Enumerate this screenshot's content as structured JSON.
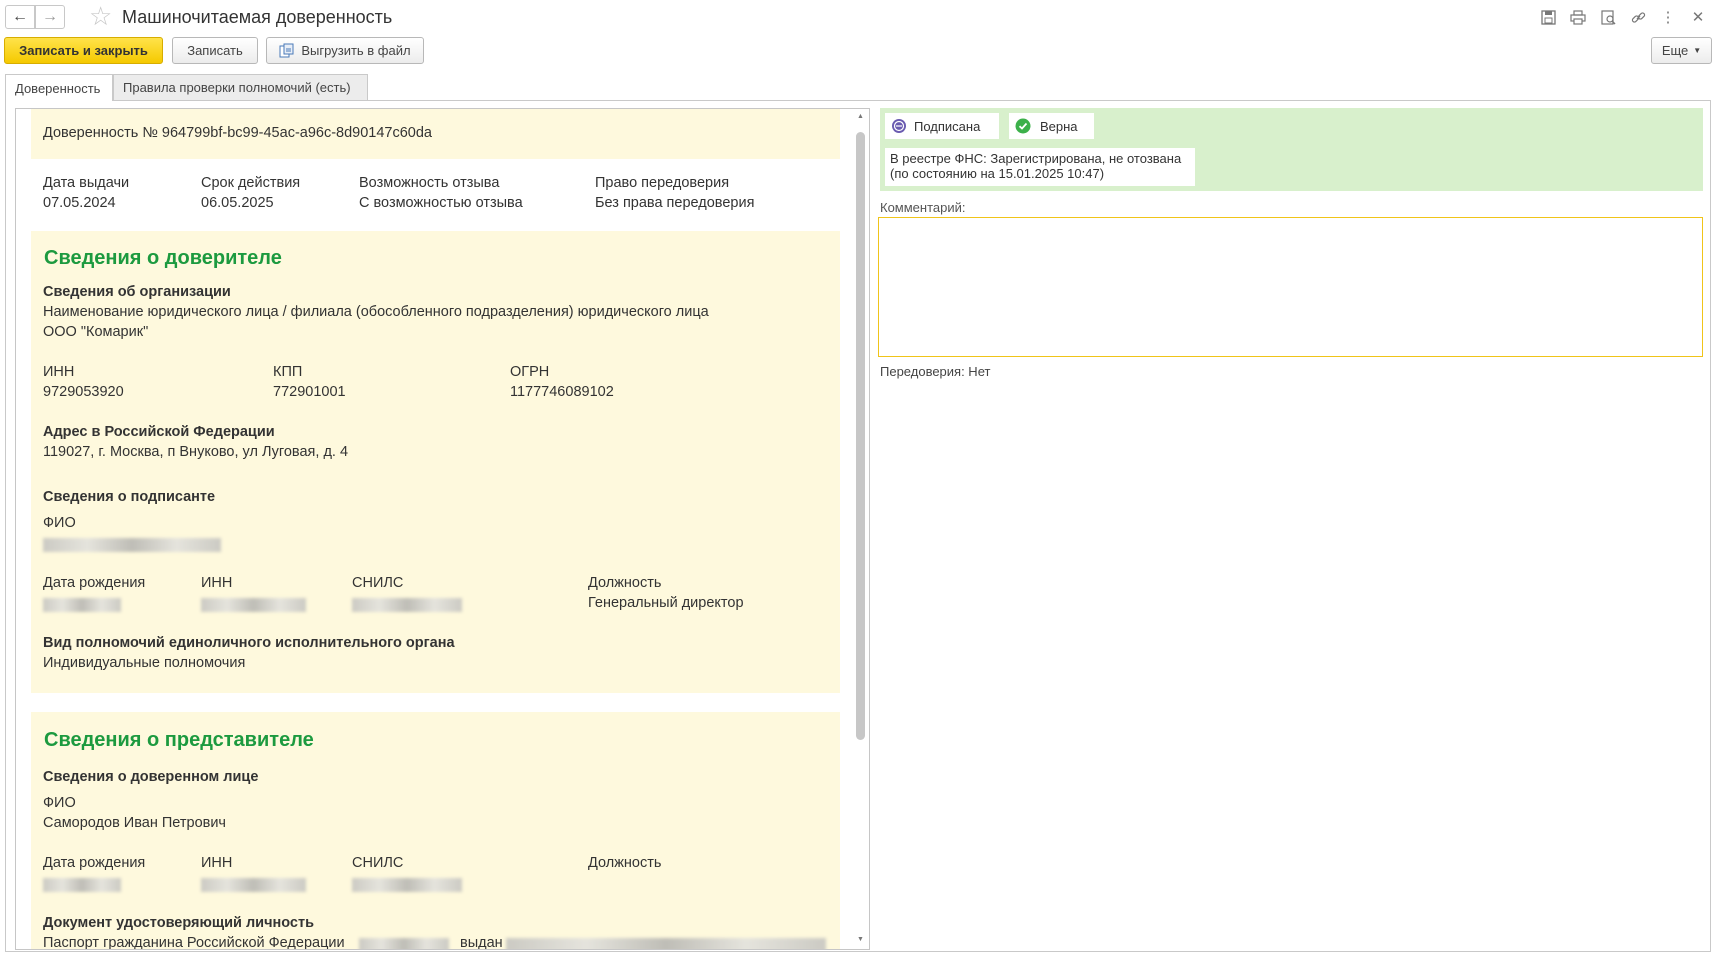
{
  "window": {
    "title": "Машиночитаемая доверенность"
  },
  "toolbar": {
    "save_close": "Записать и закрыть",
    "save": "Записать",
    "export": "Выгрузить в файл",
    "more": "Еще"
  },
  "tabs": [
    "Доверенность",
    "Правила проверки полномочий (есть)"
  ],
  "doc": {
    "header": "Доверенность № 964799bf-bc99-45ac-a96c-8d90147c60da",
    "fields": [
      {
        "label": "Дата выдачи",
        "value": "07.05.2024"
      },
      {
        "label": "Срок действия",
        "value": "06.05.2025"
      },
      {
        "label": "Возможность отзыва",
        "value": "С возможностью отзыва"
      },
      {
        "label": "Право передоверия",
        "value": "Без права передоверия"
      }
    ],
    "principal": {
      "title": "Сведения о доверителе",
      "org_title": "Сведения об организации",
      "org_name_label": "Наименование юридического лица / филиала (обособленного подразделения) юридического лица",
      "org_name": "ООО \"Комарик\"",
      "inn_label": "ИНН",
      "inn": "9729053920",
      "kpp_label": "КПП",
      "kpp": "772901001",
      "ogrn_label": "ОГРН",
      "ogrn": "1177746089102",
      "address_title": "Адрес в Российской Федерации",
      "address": "119027, г. Москва, п Внуково, ул Луговая, д. 4",
      "signer_title": "Сведения о подписанте",
      "fio_label": "ФИО",
      "birth_label": "Дата рождения",
      "inn2_label": "ИНН",
      "snils_label": "СНИЛС",
      "position_label": "Должность",
      "position": "Генеральный директор",
      "authority_title": "Вид полномочий единоличного исполнительного органа",
      "authority": "Индивидуальные полномочия"
    },
    "representative": {
      "title": "Сведения о представителе",
      "person_title": "Сведения о доверенном лице",
      "fio_label": "ФИО",
      "fio": "Самородов Иван Петрович",
      "birth_label": "Дата рождения",
      "inn_label": "ИНН",
      "snils_label": "СНИЛС",
      "position_label": "Должность",
      "id_doc_title": "Документ удостоверяющий личность",
      "id_doc": "Паспорт гражданина Российской Федерации",
      "id_doc_issued": "выдан"
    }
  },
  "status": {
    "signed": "Подписана",
    "valid": "Верна",
    "registry_line1": "В реестре ФНС: Зарегистрирована, не отозвана",
    "registry_line2": "(по состоянию на 15.01.2025 10:47)"
  },
  "comment_label": "Комментарий:",
  "redelegation": "Передоверия: Нет",
  "colors": {
    "primary": "#f5c900",
    "heading_green": "#1c9a3f",
    "doc_bg": "#fef9dd",
    "status_bg": "#d8f0cc"
  }
}
